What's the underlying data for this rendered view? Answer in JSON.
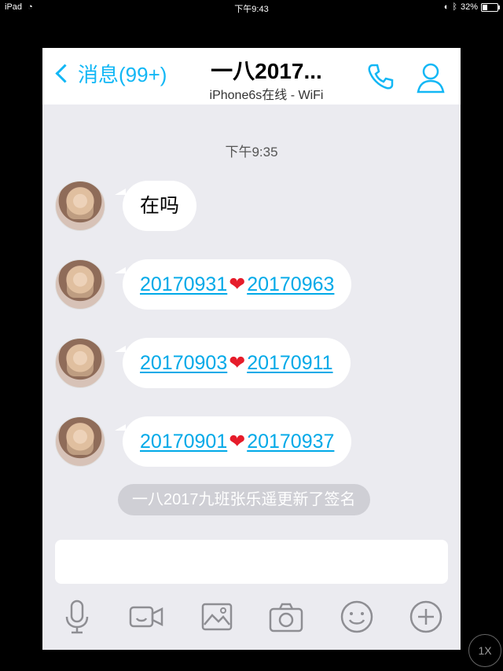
{
  "status_bar": {
    "device": "iPad",
    "time": "下午9:43",
    "battery": "32%"
  },
  "nav": {
    "back_label": "消息(99+)",
    "title": "一八2017...",
    "subtitle": "iPhone6s在线 - WiFi"
  },
  "chat": {
    "timestamp": "下午9:35",
    "messages": [
      {
        "text": "在吗"
      },
      {
        "left": "20170931",
        "right": "20170963"
      },
      {
        "left": "20170903",
        "right": "20170911"
      },
      {
        "left": "20170901",
        "right": "20170937"
      }
    ],
    "system_note": "一八2017九班张乐遥更新了签名"
  },
  "zoom_badge": "1X",
  "icons": [
    "wifi-icon",
    "bluetooth-icon",
    "battery-icon",
    "phone-call-icon",
    "profile-icon",
    "microphone-icon",
    "video-call-icon",
    "image-icon",
    "camera-icon",
    "emoji-icon",
    "plus-icon"
  ],
  "colors": {
    "accent": "#12b7f5",
    "link": "#00a9e8",
    "heart": "#e61c2a"
  }
}
